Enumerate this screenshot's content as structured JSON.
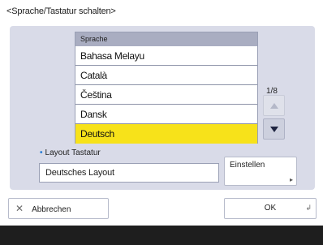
{
  "dialog": {
    "title": "<Sprache/Tastatur schalten>"
  },
  "language_list": {
    "header": "Sprache",
    "items": [
      "Bahasa Melayu",
      "Català",
      "Čeština",
      "Dansk",
      "Deutsch"
    ],
    "selected": "Deutsch"
  },
  "pagination": {
    "counter": "1/8"
  },
  "keyboard": {
    "label": "Layout Tastatur",
    "value": "Deutsches Layout",
    "set_label": "Einstellen"
  },
  "footer": {
    "cancel_label": "Abbrechen",
    "ok_label": "OK"
  },
  "colors": {
    "panel": "#d9dbe8",
    "selected": "#f7e21a",
    "accent_dot": "#2a7fd6"
  },
  "icons": {
    "cancel": "x-icon",
    "scroll_up": "triangle-up-icon",
    "scroll_down": "triangle-down-icon"
  }
}
